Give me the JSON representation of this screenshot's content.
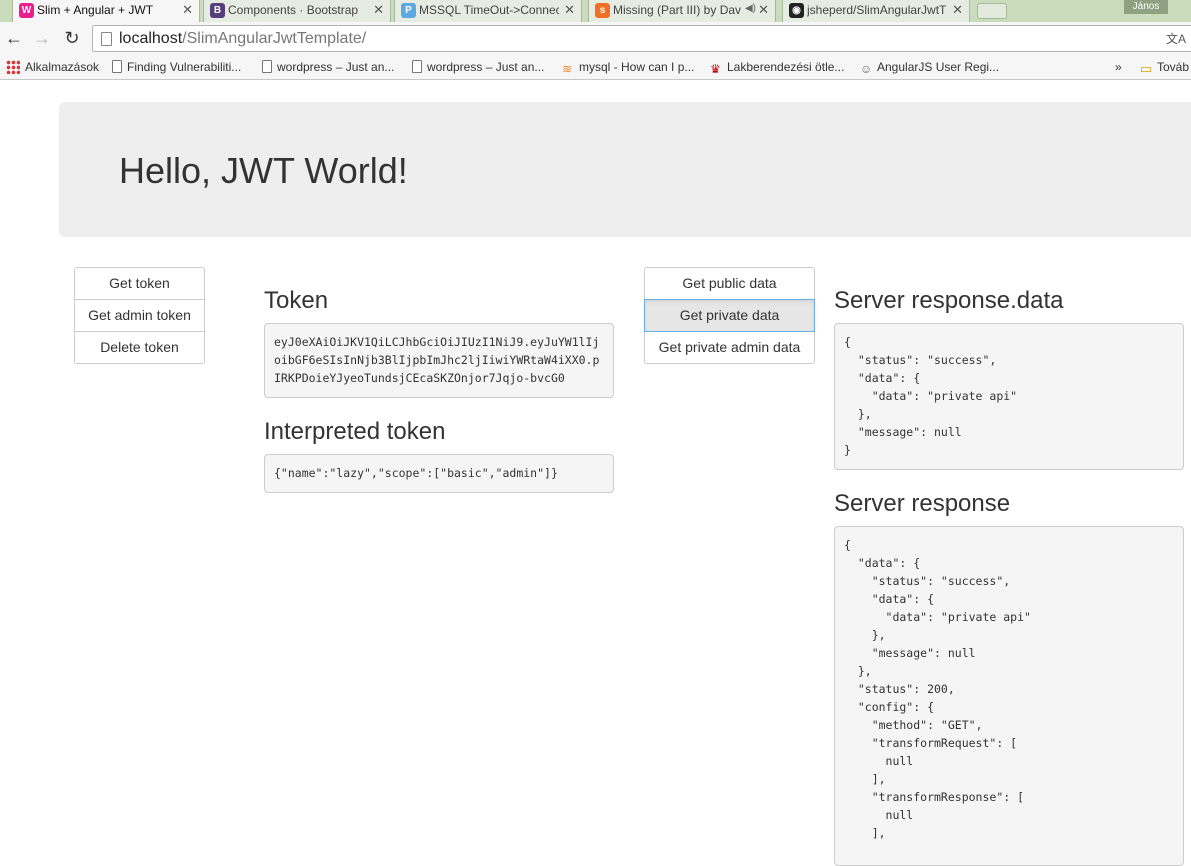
{
  "browser": {
    "tabs": [
      {
        "title": "Slim + Angular + JWT",
        "active": true,
        "favicon": "W",
        "favicon_color": "#e91e8c"
      },
      {
        "title": "Components · Bootstrap",
        "active": false,
        "favicon": "B",
        "favicon_color": "#563d7c"
      },
      {
        "title": "MSSQL TimeOut->Connec",
        "active": false,
        "favicon": "P",
        "favicon_color": "#5aa9e0"
      },
      {
        "title": "Missing (Part III) by Dav",
        "active": false,
        "favicon": "s",
        "favicon_color": "#f26f23"
      },
      {
        "title": "jsheperd/SlimAngularJwtT",
        "active": false,
        "favicon": "◉",
        "favicon_color": "#222222"
      }
    ],
    "user": "János",
    "address": {
      "host": "localhost",
      "path": "/SlimAngularJwtTemplate/"
    },
    "bookmarks": [
      {
        "label": "Alkalmazások",
        "icon": "apps-icon"
      },
      {
        "label": "Finding Vulnerabiliti...",
        "icon": "page-icon"
      },
      {
        "label": "wordpress – Just an...",
        "icon": "page-icon"
      },
      {
        "label": "wordpress – Just an...",
        "icon": "page-icon"
      },
      {
        "label": "mysql - How can I p...",
        "icon": "stackoverflow-icon"
      },
      {
        "label": "Lakberendezési ötle...",
        "icon": "crown-icon"
      },
      {
        "label": "AngularJS User Regi...",
        "icon": "person-icon"
      }
    ],
    "bookmarks_more": "»",
    "other_bookmarks": "Továb"
  },
  "page": {
    "heading": "Hello, JWT World!",
    "token_buttons": [
      "Get token",
      "Get admin token",
      "Delete token"
    ],
    "data_buttons": [
      "Get public data",
      "Get private data",
      "Get private admin data"
    ],
    "active_data_button": "Get private data",
    "token_title": "Token",
    "token_value": "eyJ0eXAiOiJKV1QiLCJhbGciOiJIUzI1NiJ9.eyJuYW1lIjoibGF6eSIsInNjb3BlIjpbImJhc2ljIiwiYWRtaW4iXX0.pIRKPDoieYJyeoTundsjCEcaSKZOnjor7Jqjo-bvcG0",
    "interpreted_title": "Interpreted token",
    "interpreted_value": "{\"name\":\"lazy\",\"scope\":[\"basic\",\"admin\"]}",
    "response_data_title": "Server response.data",
    "response_data_json": "{\n  \"status\": \"success\",\n  \"data\": {\n    \"data\": \"private api\"\n  },\n  \"message\": null\n}",
    "response_title": "Server response",
    "response_json": "{\n  \"data\": {\n    \"status\": \"success\",\n    \"data\": {\n      \"data\": \"private api\"\n    },\n    \"message\": null\n  },\n  \"status\": 200,\n  \"config\": {\n    \"method\": \"GET\",\n    \"transformRequest\": [\n      null\n    ],\n    \"transformResponse\": [\n      null\n    ],"
  }
}
